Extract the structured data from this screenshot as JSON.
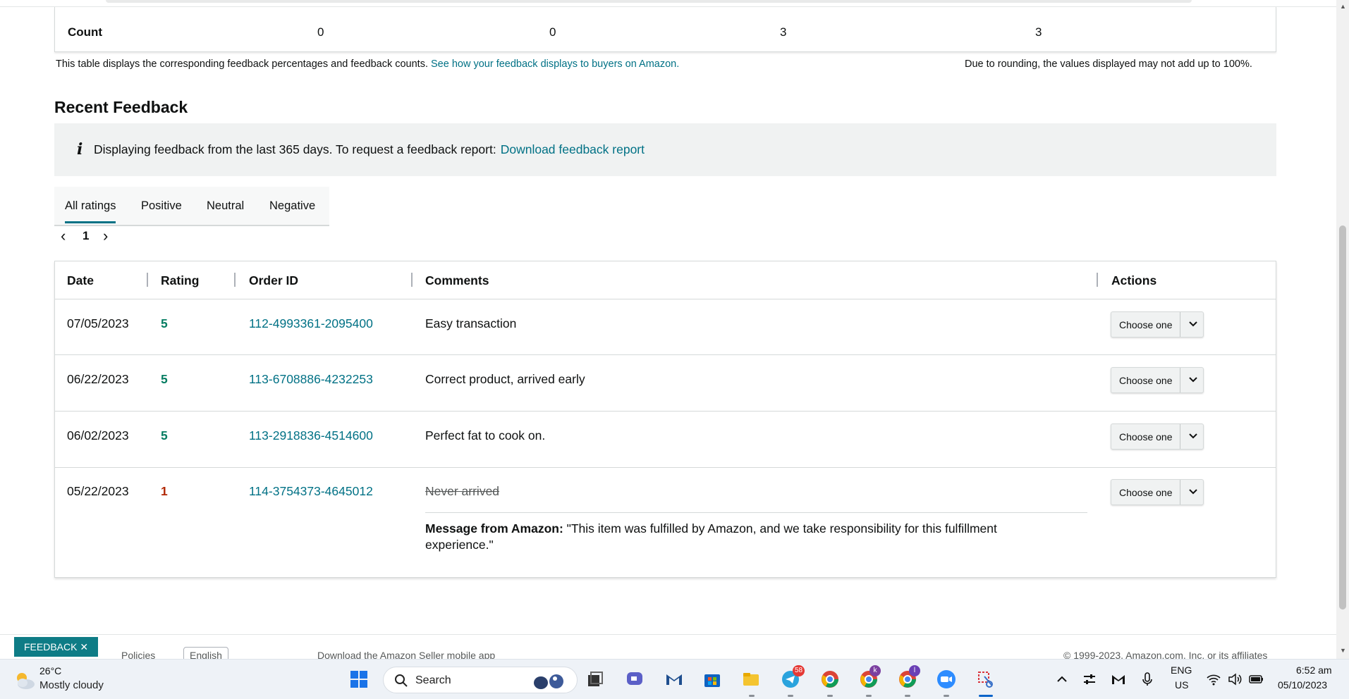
{
  "summary": {
    "count_label": "Count",
    "counts": [
      "0",
      "0",
      "3",
      "3"
    ]
  },
  "notes": {
    "left_text": "This table displays the corresponding feedback percentages and feedback counts.",
    "left_link": "See how your feedback displays to buyers on Amazon.",
    "right_text": "Due to rounding, the values displayed may not add up to 100%."
  },
  "recent": {
    "heading": "Recent Feedback",
    "info_icon": "i",
    "info_text": "Displaying feedback from the last 365 days. To request a feedback report:",
    "info_link": "Download feedback report"
  },
  "tabs": [
    "All ratings",
    "Positive",
    "Neutral",
    "Negative"
  ],
  "pager": {
    "prev": "‹",
    "page": "1",
    "next": "›"
  },
  "table": {
    "headers": [
      "Date",
      "Rating",
      "Order ID",
      "Comments",
      "Actions"
    ],
    "rows": [
      {
        "date": "07/05/2023",
        "rating": "5",
        "order_id": "112-4993361-2095400",
        "comment": "Easy transaction",
        "action": "Choose one"
      },
      {
        "date": "06/22/2023",
        "rating": "5",
        "order_id": "113-6708886-4232253",
        "comment": "Correct product, arrived early",
        "action": "Choose one"
      },
      {
        "date": "06/02/2023",
        "rating": "5",
        "order_id": "113-2918836-4514600",
        "comment": "Perfect fat to cook on.",
        "action": "Choose one"
      },
      {
        "date": "05/22/2023",
        "rating": "1",
        "order_id": "114-3754373-4645012",
        "comment": "Never arrived",
        "action": "Choose one",
        "message_label": "Message from Amazon:",
        "message_text": "\"This item was fulfilled by Amazon, and we take responsibility for this fulfillment experience.\""
      }
    ]
  },
  "footer": {
    "feedback_button": "FEEDBACK ✕",
    "policies": "Policies",
    "language": "English",
    "download_app": "Download the Amazon Seller mobile app",
    "copyright": "© 1999-2023, Amazon.com, Inc. or its affiliates"
  },
  "taskbar": {
    "temperature": "26°C",
    "weather": "Mostly cloudy",
    "search_label": "Search",
    "telegram_badge": "58",
    "chrome_badge_k": "k",
    "chrome_badge_l": "l",
    "lang_top": "ENG",
    "lang_bottom": "US",
    "time": "6:52 am",
    "date": "05/10/2023"
  },
  "colors": {
    "link": "#007185",
    "positive": "#067d62",
    "negative": "#b12704",
    "feedback_btn": "#0e7c86"
  }
}
